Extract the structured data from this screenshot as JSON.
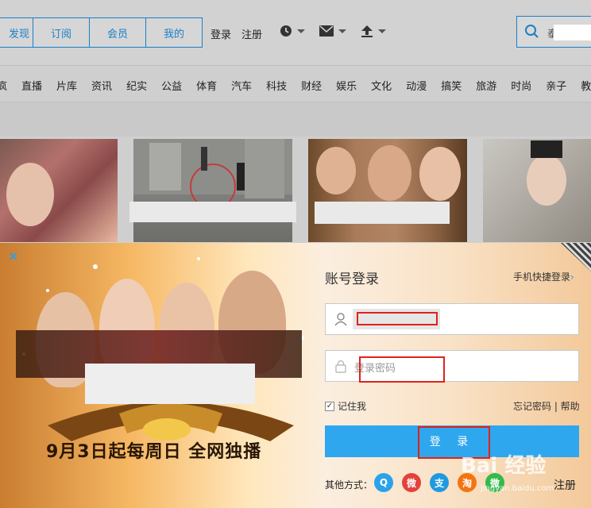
{
  "header": {
    "tabs": [
      "发现",
      "订阅",
      "会员",
      "我的"
    ],
    "login": "登录",
    "register": "注册",
    "search_prefix": "泰"
  },
  "categories": [
    "疯",
    "直播",
    "片库",
    "资讯",
    "纪实",
    "公益",
    "体育",
    "汽车",
    "科技",
    "财经",
    "娱乐",
    "文化",
    "动漫",
    "搞笑",
    "旅游",
    "时尚",
    "亲子",
    "教"
  ],
  "promo": {
    "slogan": "9月3日起每周日 全网独播"
  },
  "login_dialog": {
    "close": "×",
    "title": "账号登录",
    "quick_login": "手机快捷登录",
    "password_placeholder": "登录密码",
    "remember": "记住我",
    "forgot": "忘记密码 | 帮助",
    "submit": "登 录",
    "other": "其他方式：",
    "register": "注册"
  },
  "social": [
    {
      "icon": "qq-icon",
      "color": "#2aa3ea",
      "glyph": "Q"
    },
    {
      "icon": "weibo-icon",
      "color": "#e4423d",
      "glyph": "微"
    },
    {
      "icon": "alipay-icon",
      "color": "#1f9ae0",
      "glyph": "支"
    },
    {
      "icon": "taobao-icon",
      "color": "#f5740f",
      "glyph": "淘"
    },
    {
      "icon": "wechat-icon",
      "color": "#34b94b",
      "glyph": "微"
    }
  ],
  "watermark": {
    "text": "Bai 经验",
    "url": "jingyan.baidu.com"
  }
}
